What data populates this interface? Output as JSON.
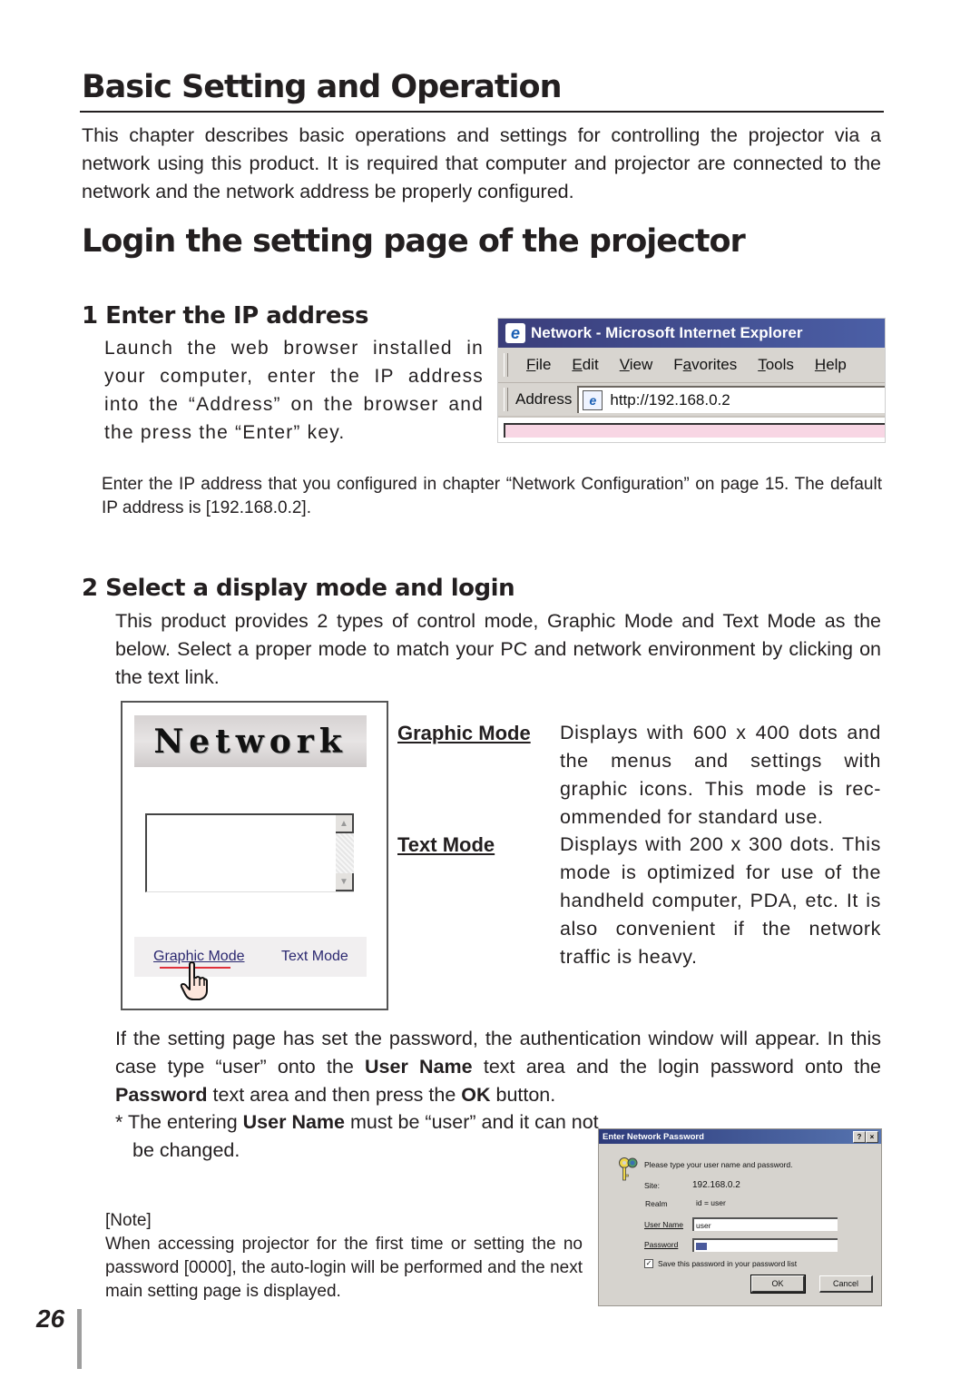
{
  "page": {
    "title": "Basic Setting and Operation",
    "intro": "This chapter describes basic operations and settings for controlling the projector via a network using this product. It is required that computer and projector are connected to the network and the network address be properly configured.",
    "section_title": "Login the setting page of the projector",
    "page_number": "26"
  },
  "step1": {
    "heading": "1 Enter the IP address",
    "body": "Launch the web browser installed in your computer, enter the IP address into the “Address” on the browser and the press the “Enter” key.",
    "note": "Enter the IP address that you configured in chapter “Network Configuration” on page 15. The default IP address is [192.168.0.2]."
  },
  "browser": {
    "window_title": "Network - Microsoft Internet Explorer",
    "menu": [
      {
        "label": "File",
        "accel": "F"
      },
      {
        "label": "Edit",
        "accel": "E"
      },
      {
        "label": "View",
        "accel": "V"
      },
      {
        "label": "Favorites",
        "accel": "a"
      },
      {
        "label": "Tools",
        "accel": "T"
      },
      {
        "label": "Help",
        "accel": "H"
      }
    ],
    "address_label": "Address",
    "address_value": "http://192.168.0.2",
    "icon": "ie-logo-icon"
  },
  "step2": {
    "heading": "2 Select a display mode and login",
    "body": "This product provides 2 types of control mode, Graphic Mode and Text Mode as the below. Select a proper mode to match your PC and network environment by clicking on the text link.",
    "modes": [
      {
        "label": "Graphic Mode",
        "description": "Displays with 600 x 400 dots and the menus and settings with graphic icons. This mode is rec-ommended for standard use."
      },
      {
        "label": "Text Mode",
        "description": "Displays with 200 x 300 dots. This mode is optimized for use of the handheld computer, PDA, etc. It is also convenient if the network traffic is heavy."
      }
    ],
    "auth_paragraph": {
      "part1": "If the setting page has set the password, the authentication window will appear. In this case type “user” onto the ",
      "bold1": "User Name",
      "part2": " text area and the login password onto the ",
      "bold2": "Password",
      "part3": " text area and then press the ",
      "bold3": "OK",
      "part4": " button."
    },
    "asterisk_note": {
      "prefix": "* The entering ",
      "bold": "User Name",
      "suffix": " must be “user” and it can not be changed."
    },
    "note_label": "[Note]",
    "note_body": "When accessing projector for the first time or setting the no password [0000], the auto-login will be performed and the next main setting page is displayed."
  },
  "network_page": {
    "banner": "Network",
    "links": [
      "Graphic Mode",
      "Text Mode"
    ],
    "cursor": "hand-pointer-icon"
  },
  "password_dialog": {
    "title": "Enter Network Password",
    "help_btn": "?",
    "close_btn": "×",
    "prompt": "Please type your user name and password.",
    "site_label": "Site:",
    "site_value": "192.168.0.2",
    "realm_label": "Realm",
    "realm_value": "id = user",
    "username_label": "User Name",
    "username_value": "user",
    "password_label": "Password",
    "save_label": "Save this password in your password list",
    "save_checked": true,
    "ok_label": "OK",
    "cancel_label": "Cancel"
  }
}
